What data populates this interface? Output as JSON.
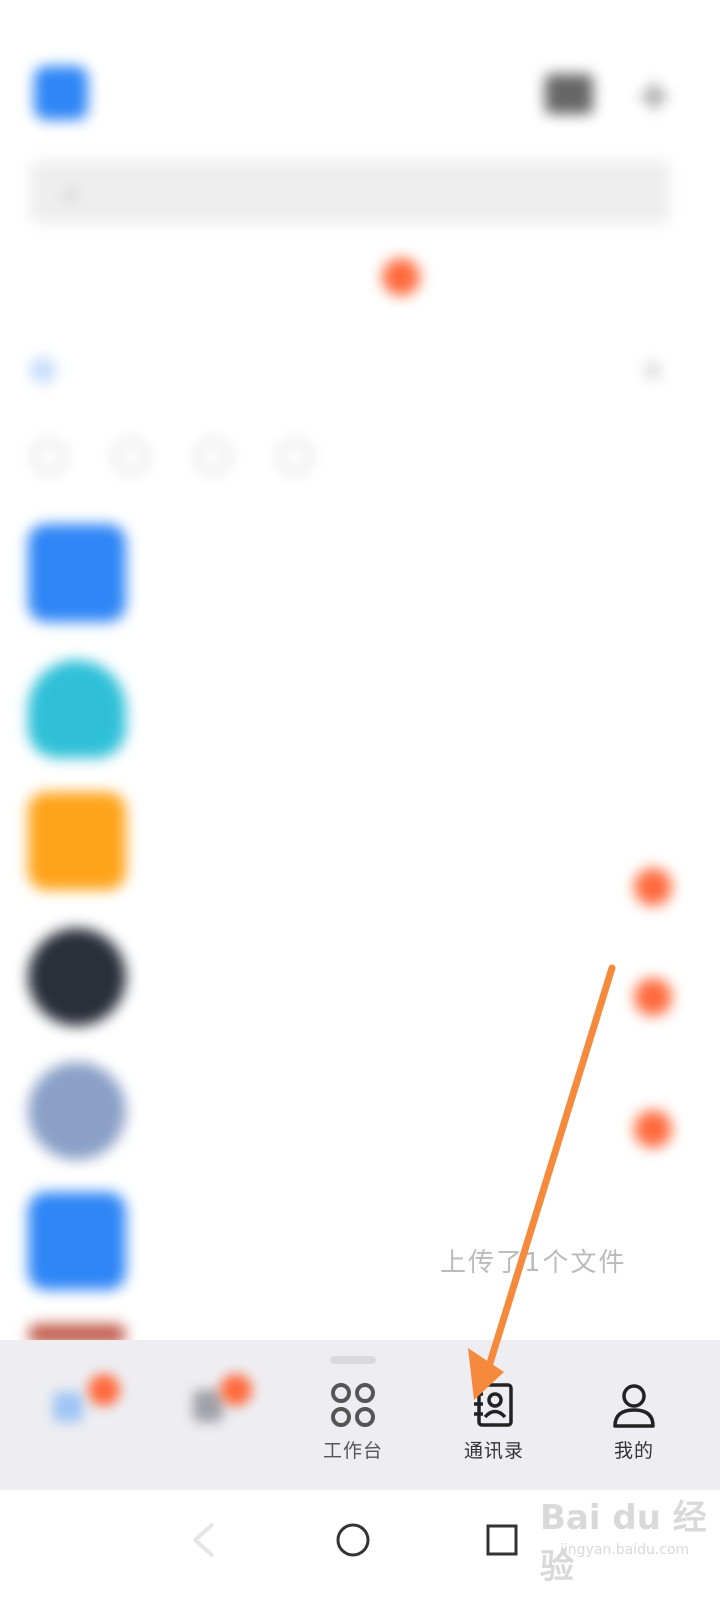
{
  "status_bar": {
    "time": "",
    "right": ""
  },
  "header": {
    "org_name": "",
    "search_placeholder": ""
  },
  "quick_actions": [
    {
      "label": ""
    },
    {
      "label": ""
    },
    {
      "label": ""
    }
  ],
  "banner": {
    "text": ""
  },
  "chats": [
    {
      "name": "",
      "preview": "",
      "avatar_color": "#2f86f6",
      "tag": "",
      "has_badge": false
    },
    {
      "name": "",
      "preview": "",
      "avatar_color": "#2fc0d8",
      "tag": "",
      "has_badge": true
    },
    {
      "name": "",
      "preview": "",
      "avatar_color": "#ffa31a",
      "tag": "",
      "has_badge": true
    },
    {
      "name": "",
      "preview": "",
      "avatar_color": "#2a2f3a",
      "tag": "",
      "has_badge": true
    },
    {
      "name": "",
      "preview": "",
      "avatar_color": "#8aa0c7",
      "tag": "",
      "has_badge": true
    },
    {
      "name": "",
      "preview": "",
      "avatar_color": "#2f86f6",
      "tag": "",
      "has_badge": false
    }
  ],
  "clear_preview_text": "上传了1个文件",
  "bottom_nav": {
    "items": [
      {
        "id": "messages",
        "label": "",
        "icon": "message-icon"
      },
      {
        "id": "docs",
        "label": "",
        "icon": "docs-icon"
      },
      {
        "id": "workbench",
        "label": "工作台",
        "icon": "grid-icon"
      },
      {
        "id": "contacts",
        "label": "通讯录",
        "icon": "contacts-icon"
      },
      {
        "id": "me",
        "label": "我的",
        "icon": "person-icon"
      }
    ]
  },
  "watermark": {
    "brand": "Bai du 经验",
    "url": "jingyan.baidu.com"
  },
  "colors": {
    "accent": "#2f86f6",
    "badge": "#ff6a3d",
    "annotation_arrow": "#f58a3d",
    "nav_bg": "#eeeef2"
  }
}
